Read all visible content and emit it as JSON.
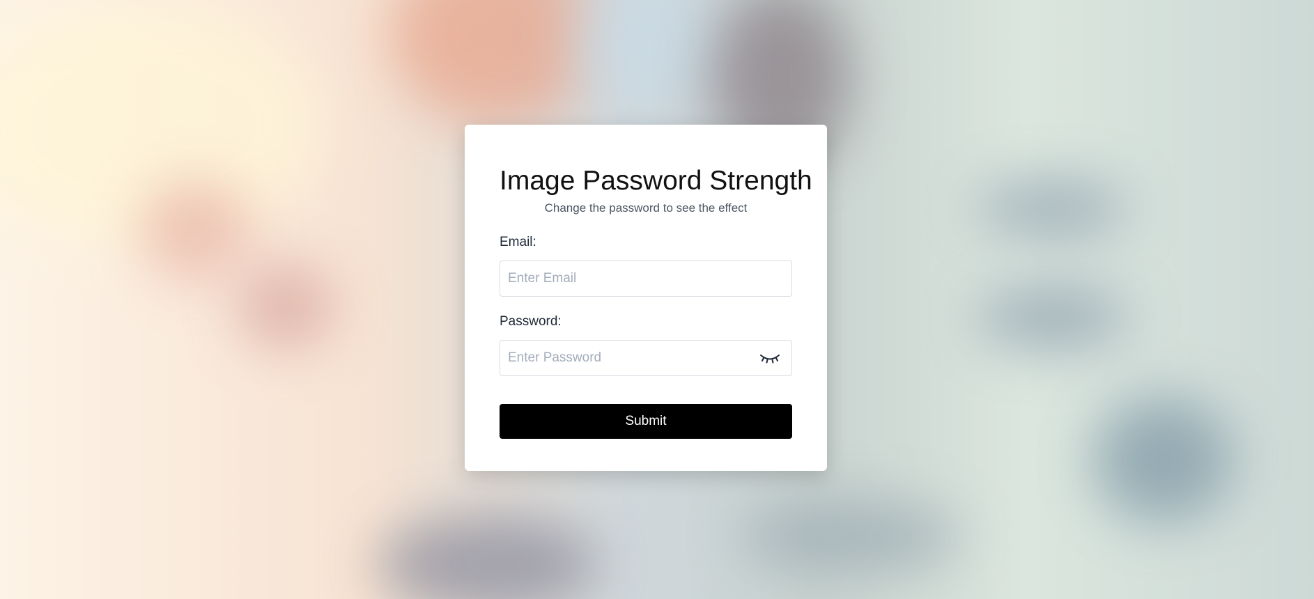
{
  "page": {
    "title": "Image Password Strength",
    "subtitle": "Change the password to see the effect"
  },
  "form": {
    "email_label": "Email:",
    "email_placeholder": "Enter Email",
    "email_value": "",
    "password_label": "Password:",
    "password_placeholder": "Enter Password",
    "password_value": "",
    "toggle_icon": "eye-closed-icon",
    "submit_label": "Submit"
  },
  "colors": {
    "card_background": "#ffffff",
    "button_background": "#000000",
    "button_text": "#ffffff",
    "placeholder": "#a3adbb"
  }
}
